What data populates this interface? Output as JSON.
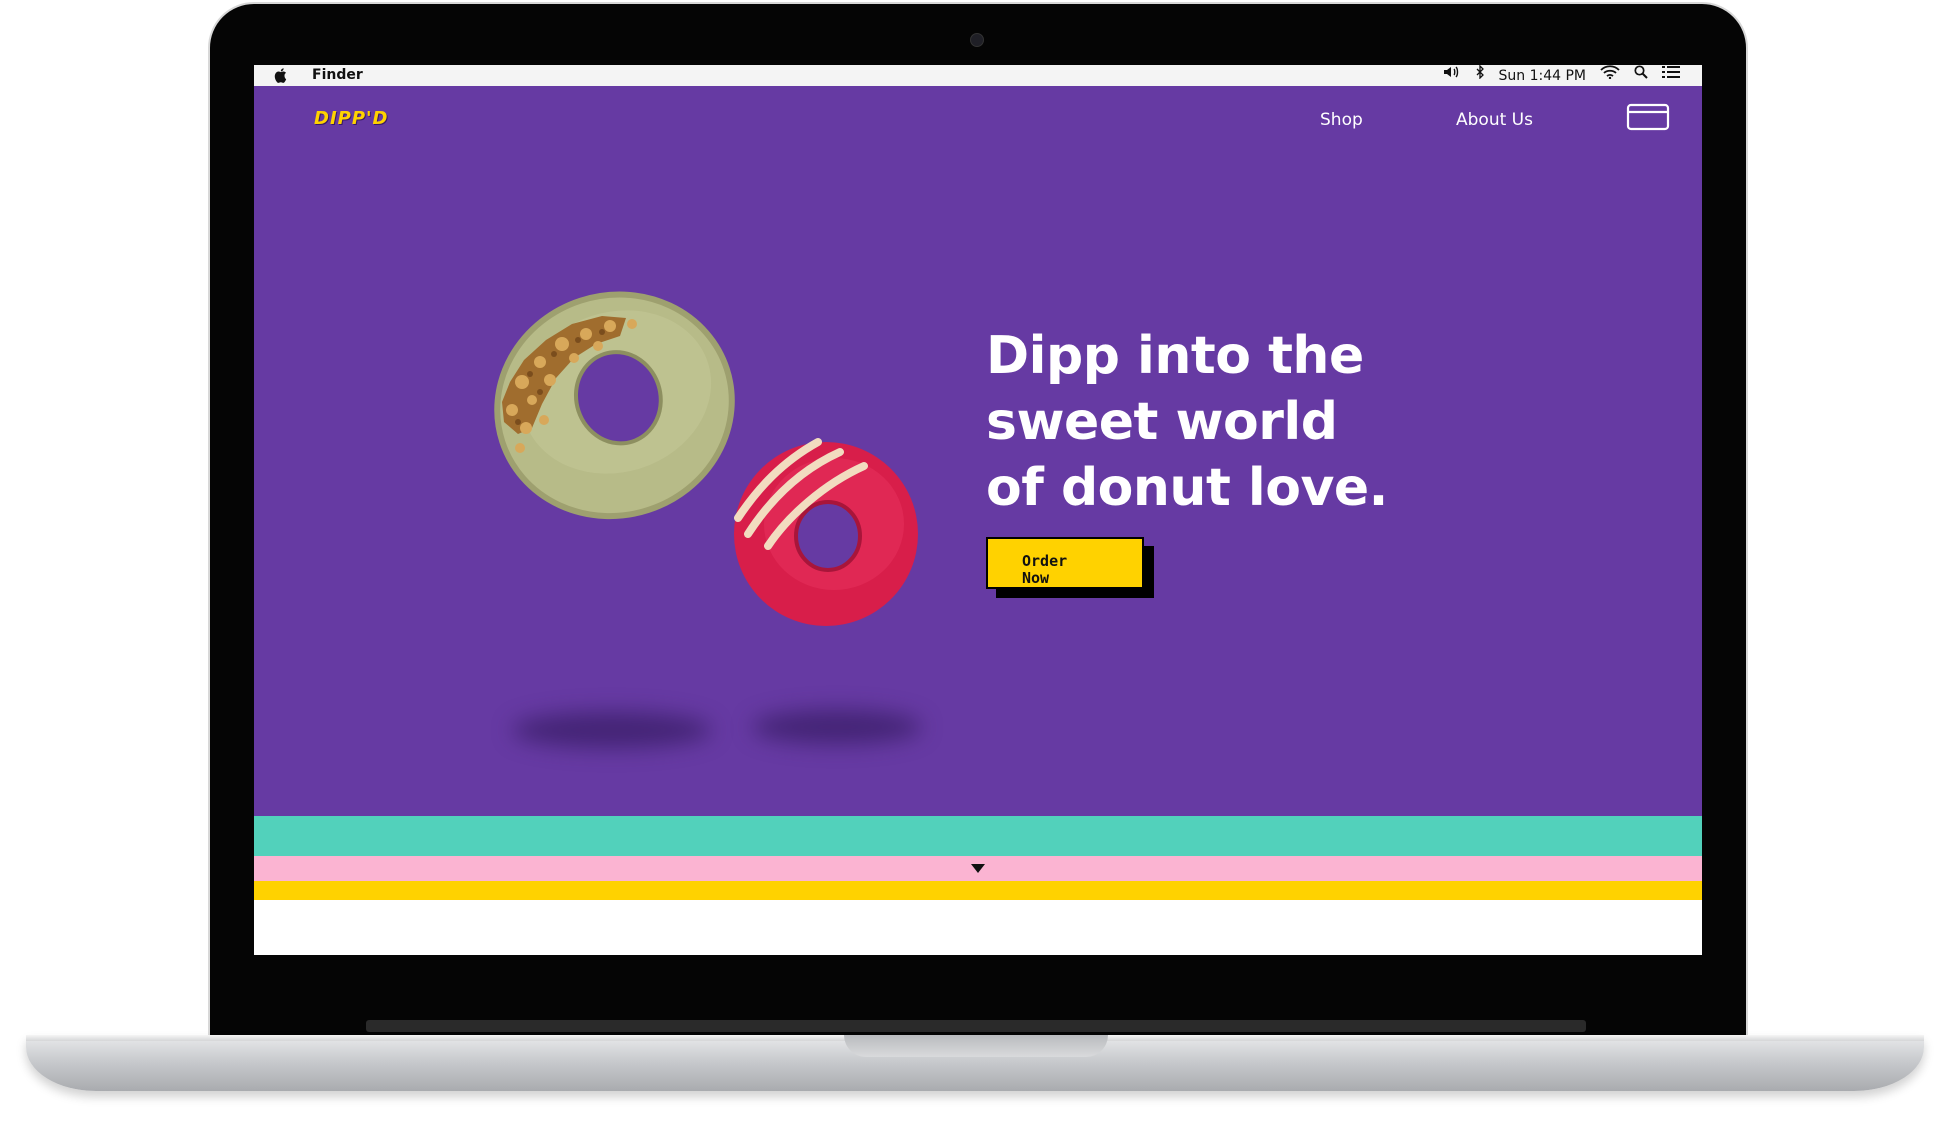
{
  "menubar": {
    "app_name": "Finder",
    "clock": "Sun 1:44 PM",
    "icons": [
      "apple-icon",
      "volume-icon",
      "bluetooth-icon",
      "wifi-icon",
      "search-icon",
      "list-icon"
    ]
  },
  "site": {
    "logo": "DIPP'D",
    "nav": {
      "shop": "Shop",
      "about": "About Us"
    },
    "cart_icon": "cart-icon",
    "hero": {
      "headline_lines": [
        "Dipp into the",
        "sweet world",
        "of donut love."
      ],
      "cta_label": "Order Now"
    },
    "stripe_colors": [
      "#52d1bb",
      "#fbb4d2",
      "#ffd200"
    ],
    "brand_colors": {
      "background": "#663aa3",
      "accent": "#ffd200"
    }
  }
}
